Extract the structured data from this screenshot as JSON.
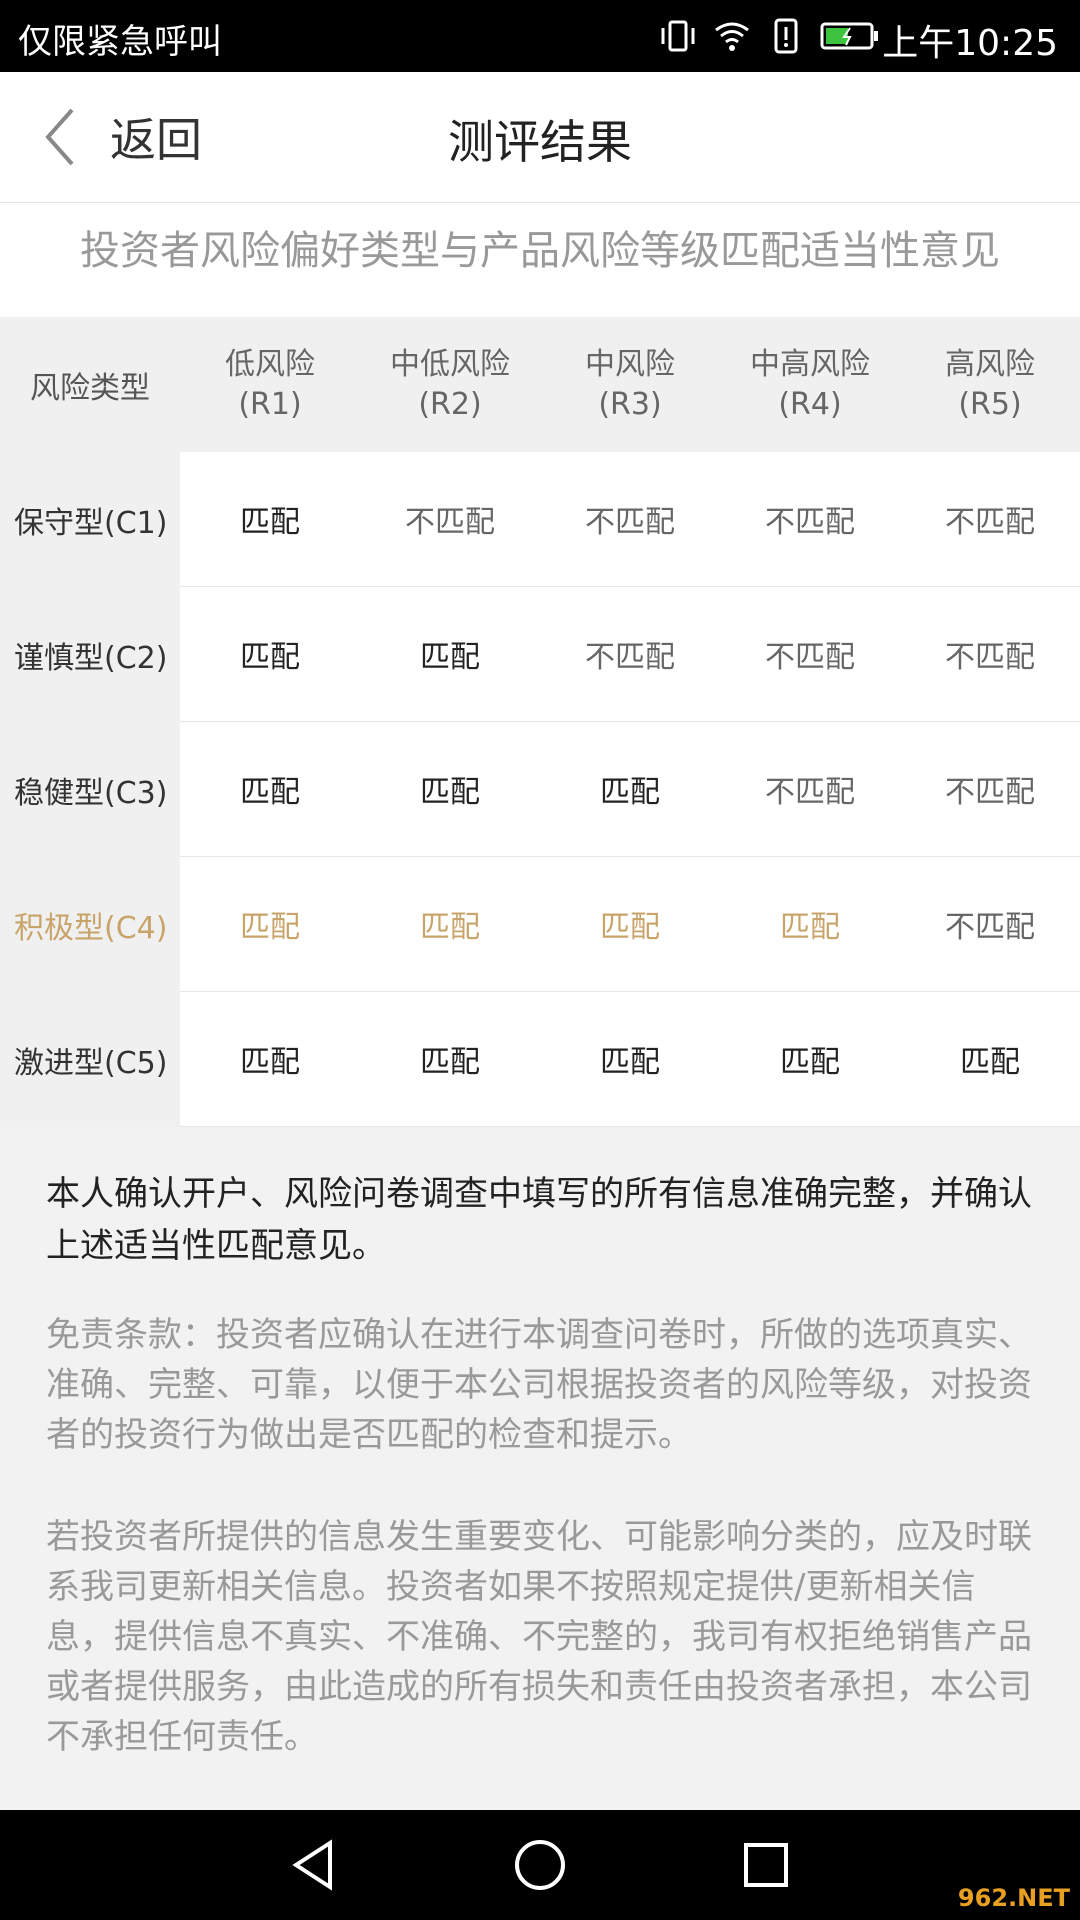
{
  "status_bar": {
    "carrier": "仅限紧急呼叫",
    "time": "上午10:25",
    "icons": [
      "vibrate-icon",
      "wifi-icon",
      "alert-icon",
      "battery-charging-icon"
    ]
  },
  "header": {
    "back_label": "返回",
    "title": "测评结果"
  },
  "subtitle": "投资者风险偏好类型与产品风险等级匹配适当性意见",
  "table": {
    "corner_label": "风险类型",
    "columns": [
      {
        "name": "低风险",
        "code": "(R1)"
      },
      {
        "name": "中低风险",
        "code": "(R2)"
      },
      {
        "name": "中风险",
        "code": "(R3)"
      },
      {
        "name": "中高风险",
        "code": "(R4)"
      },
      {
        "name": "高风险",
        "code": "(R5)"
      }
    ],
    "rows": [
      {
        "label": "保守型(C1)",
        "cells": [
          "匹配",
          "不匹配",
          "不匹配",
          "不匹配",
          "不匹配"
        ]
      },
      {
        "label": "谨慎型(C2)",
        "cells": [
          "匹配",
          "匹配",
          "不匹配",
          "不匹配",
          "不匹配"
        ]
      },
      {
        "label": "稳健型(C3)",
        "cells": [
          "匹配",
          "匹配",
          "匹配",
          "不匹配",
          "不匹配"
        ]
      },
      {
        "label": "积极型(C4)",
        "cells": [
          "匹配",
          "匹配",
          "匹配",
          "匹配",
          "不匹配"
        ],
        "highlighted": true
      },
      {
        "label": "激进型(C5)",
        "cells": [
          "匹配",
          "匹配",
          "匹配",
          "匹配",
          "匹配"
        ]
      }
    ],
    "highlight_color": "#c9a46a"
  },
  "confirm_text": "本人确认开户、风险问卷调查中填写的所有信息准确完整，并确认上述适当性匹配意见。",
  "disclaimer_text": "免责条款：投资者应确认在进行本调查问卷时，所做的选项真实、准确、完整、可靠，以便于本公司根据投资者的风险等级，对投资者的投资行为做出是否匹配的检查和提示。",
  "notice_text": "若投资者所提供的信息发生重要变化、可能影响分类的，应及时联系我司更新相关信息。投资者如果不按照规定提供/更新相关信息，提供信息不真实、不准确、不完整的，我司有权拒绝销售产品或者提供服务，由此造成的所有损失和责任由投资者承担，本公司不承担任何责任。",
  "nav_bar": {
    "buttons": [
      "back-triangle-icon",
      "home-circle-icon",
      "recents-square-icon"
    ]
  },
  "watermark": "962.NET"
}
